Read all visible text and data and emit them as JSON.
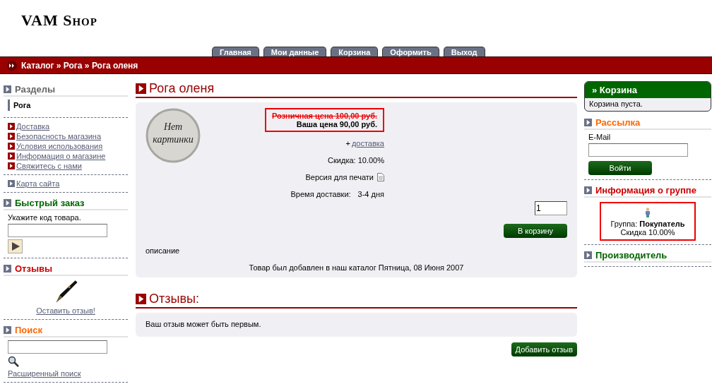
{
  "logo": "VAM Shop",
  "tabs": [
    {
      "label": "Главная"
    },
    {
      "label": "Мои данные"
    },
    {
      "label": "Корзина"
    },
    {
      "label": "Оформить"
    },
    {
      "label": "Выход"
    }
  ],
  "breadcrumb": "Каталог » Рога » Рога оленя",
  "left": {
    "sections": {
      "title": "Разделы",
      "color": "#666666",
      "current": "Рога"
    },
    "links": [
      "Доставка",
      "Безопасность магазина",
      "Условия использования",
      "Информация о магазине",
      "Свяжитесь с нами"
    ],
    "sitemap": "Карта сайта",
    "quick_order": {
      "title": "Быстрый заказ",
      "color": "#006600",
      "label": "Укажите код товара."
    },
    "reviews": {
      "title": "Отзывы",
      "color": "#cc0000",
      "link": "Оставить отзыв!"
    },
    "search": {
      "title": "Поиск",
      "color": "#ff6600",
      "advanced": "Расширенный поиск"
    }
  },
  "product": {
    "title": "Рога оленя",
    "no_image": "Нет картинки",
    "old_price": "Розничная цена 100,00 руб.",
    "price": "Ваша цена 90,00 руб.",
    "shipping_prefix": "+",
    "shipping_link": "доставка",
    "discount": "Скидка: 10.00%",
    "print": "Версия для печати",
    "delivery_label": "Время доставки:",
    "delivery_value": "3-4 дня",
    "quantity": "1",
    "cart_button": "В корзину",
    "description": "описание",
    "added": "Товар был добавлен в наш каталог Пятница, 08 Июня 2007"
  },
  "reviews": {
    "title": "Отзывы:",
    "empty": "Ваш отзыв может быть первым.",
    "add_button": "Добавить отзыв"
  },
  "right": {
    "cart": {
      "title": "» Корзина",
      "text": "Корзина пуста."
    },
    "newsletter": {
      "title": "Рассылка",
      "color": "#ff6600",
      "label": "E-Mail",
      "button": "Войти"
    },
    "group": {
      "title": "Информация о группе",
      "color": "#cc0000",
      "label": "Группа:",
      "name": "Покупатель",
      "discount": "Скидка 10.00%"
    },
    "manufacturer": {
      "title": "Производитель",
      "color": "#006600"
    }
  }
}
